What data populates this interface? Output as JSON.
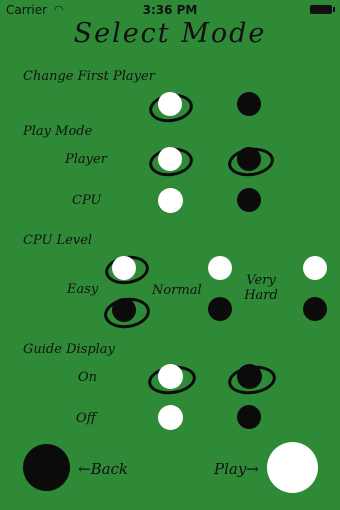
{
  "status_bar": {
    "carrier": "Carrier",
    "wifi": "wifi-icon",
    "time": "3:36 PM",
    "battery": "battery-icon"
  },
  "title": "Select Mode",
  "sections": {
    "change_first_player": "Change First Player",
    "play_mode": "Play Mode",
    "cpu_level": "CPU Level",
    "guide_display": "Guide Display"
  },
  "options": {
    "player": "Player",
    "cpu": "CPU",
    "easy": "Easy",
    "normal": "Normal",
    "very_hard_line1": "Very",
    "very_hard_line2": "Hard",
    "on": "On",
    "off": "Off"
  },
  "nav": {
    "back": "←Back",
    "play": "Play→"
  },
  "selections": {
    "first_player": "white",
    "play_mode_player": "both",
    "cpu_level": "easy (white) / easy (black)",
    "guide_display": "on"
  }
}
